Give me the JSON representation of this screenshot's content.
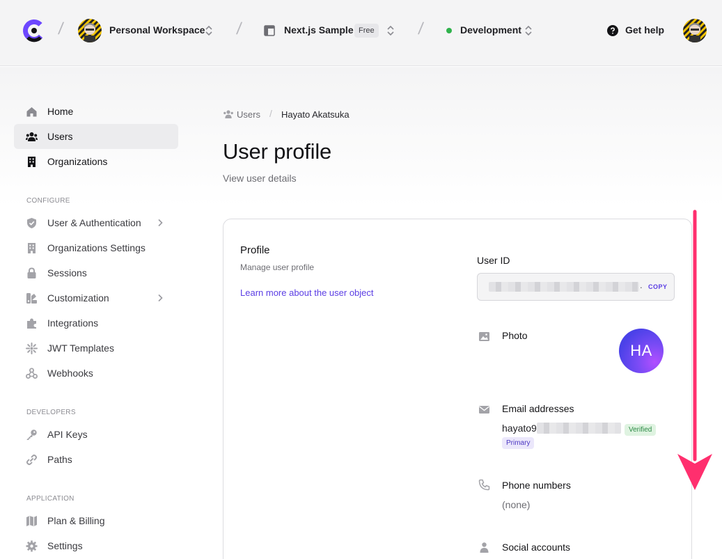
{
  "topbar": {
    "workspace_name": "Personal Workspace",
    "app_name": "Next.js Sample",
    "plan_badge": "Free",
    "environment": "Development",
    "help_label": "Get help"
  },
  "colors": {
    "brand_purple": "#6c47ff",
    "link": "#5b3ee4",
    "environment_dot": "#2fb24c",
    "scroll_arrow": "#ff2f6e"
  },
  "sidebar": {
    "main": [
      {
        "label": "Home",
        "icon": "home-icon"
      },
      {
        "label": "Users",
        "icon": "users-icon",
        "active": true
      },
      {
        "label": "Organizations",
        "icon": "building-icon"
      }
    ],
    "configure_heading": "CONFIGURE",
    "configure": [
      {
        "label": "User & Authentication",
        "icon": "shield-icon",
        "has_submenu": true
      },
      {
        "label": "Organizations Settings",
        "icon": "building-icon"
      },
      {
        "label": "Sessions",
        "icon": "lock-icon"
      },
      {
        "label": "Customization",
        "icon": "palette-icon",
        "has_submenu": true
      },
      {
        "label": "Integrations",
        "icon": "puzzle-icon"
      },
      {
        "label": "JWT Templates",
        "icon": "sparkle-icon"
      },
      {
        "label": "Webhooks",
        "icon": "webhook-icon"
      }
    ],
    "developers_heading": "DEVELOPERS",
    "developers": [
      {
        "label": "API Keys",
        "icon": "key-icon"
      },
      {
        "label": "Paths",
        "icon": "link-icon"
      }
    ],
    "application_heading": "APPLICATION",
    "application": [
      {
        "label": "Plan & Billing",
        "icon": "map-icon"
      },
      {
        "label": "Settings",
        "icon": "gear-icon"
      }
    ]
  },
  "breadcrumb": {
    "parent": "Users",
    "current": "Hayato Akatsuka"
  },
  "page": {
    "title": "User profile",
    "subtitle": "View user details"
  },
  "profile_card": {
    "title": "Profile",
    "subtitle": "Manage user profile",
    "learn_more": "Learn more about the user object",
    "user_id_label": "User ID",
    "user_id_end": ".",
    "copy_label": "COPY",
    "photo_label": "Photo",
    "avatar_initials": "HA",
    "email_label": "Email addresses",
    "email_visible": "hayato9",
    "email_verified": "Verified",
    "email_primary": "Primary",
    "phone_label": "Phone numbers",
    "phone_value": "(none)",
    "social_label": "Social accounts"
  }
}
